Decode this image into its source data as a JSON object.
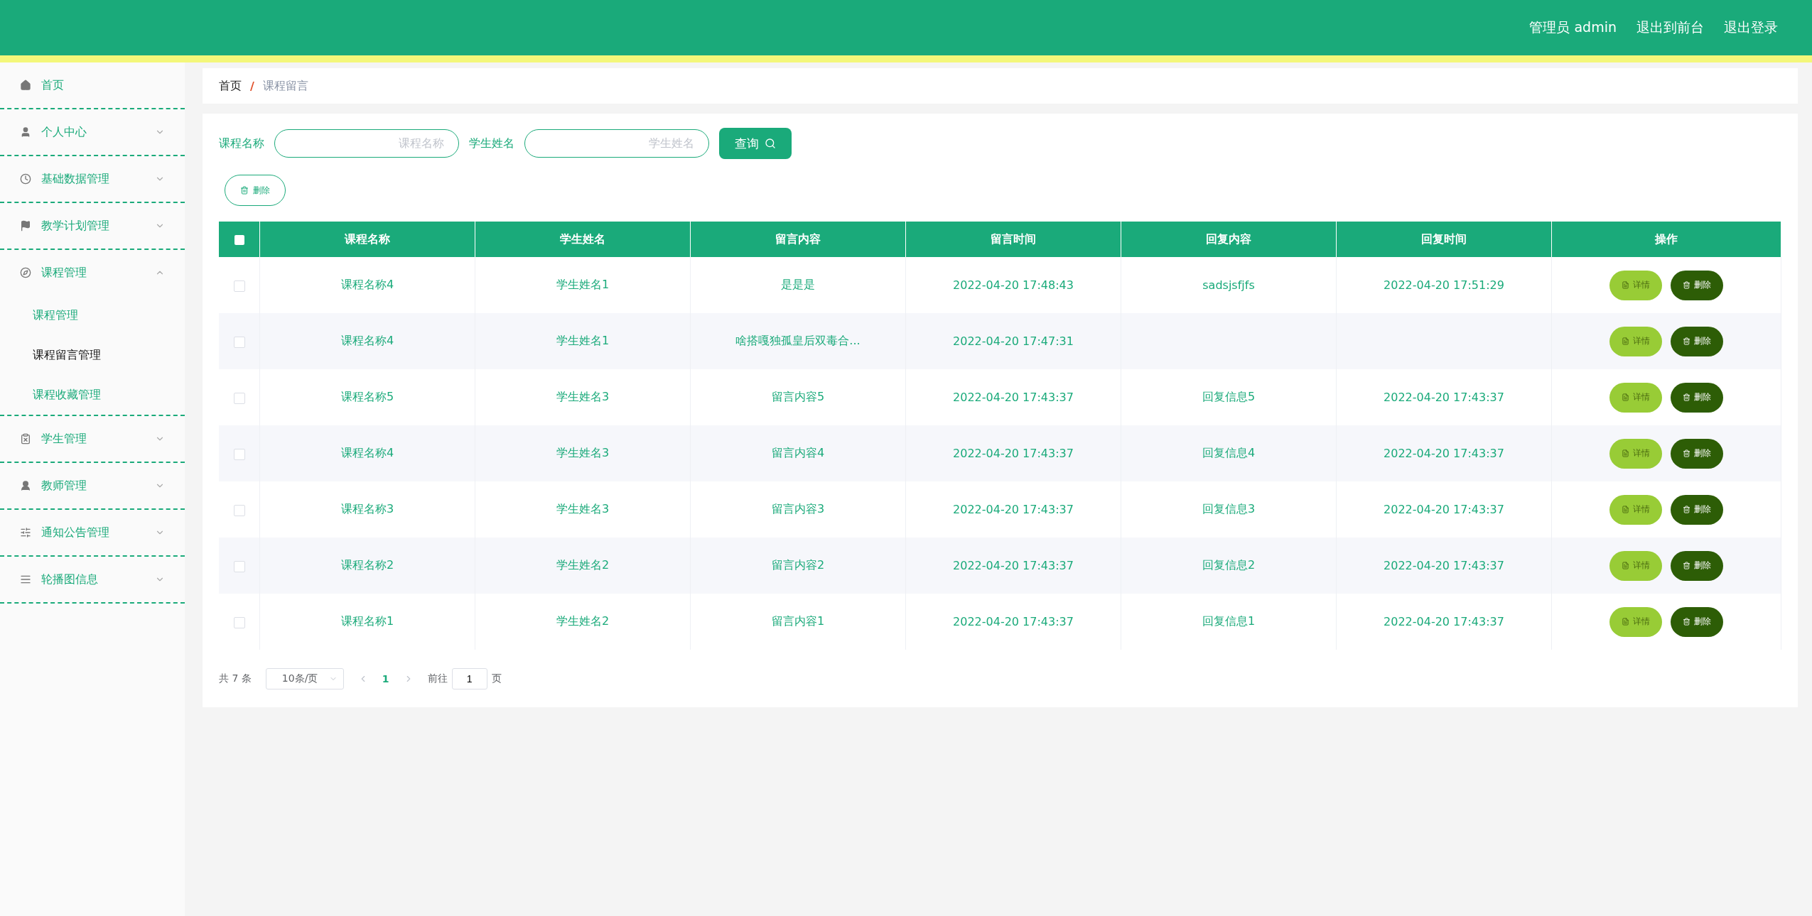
{
  "header": {
    "user": "管理员 admin",
    "links": [
      "退出到前台",
      "退出登录"
    ]
  },
  "sidebar": {
    "items": [
      {
        "label": "首页"
      },
      {
        "label": "个人中心",
        "expanded": false
      },
      {
        "label": "基础数据管理",
        "expanded": false
      },
      {
        "label": "教学计划管理",
        "expanded": false
      },
      {
        "label": "课程管理",
        "expanded": true,
        "children": [
          {
            "label": "课程管理",
            "selected": false
          },
          {
            "label": "课程留言管理",
            "selected": true
          },
          {
            "label": "课程收藏管理",
            "selected": false
          }
        ]
      },
      {
        "label": "学生管理",
        "expanded": false
      },
      {
        "label": "教师管理",
        "expanded": false
      },
      {
        "label": "通知公告管理",
        "expanded": false
      },
      {
        "label": "轮播图信息",
        "expanded": false
      }
    ]
  },
  "breadcrumb": {
    "home": "首页",
    "separator": "/",
    "current": "课程留言"
  },
  "filters": [
    {
      "label": "课程名称",
      "placeholder": "课程名称"
    },
    {
      "label": "学生姓名",
      "placeholder": "学生姓名"
    }
  ],
  "search_button": "查询",
  "delete_button": "删除",
  "table": {
    "select_all_checked": false,
    "columns": [
      "课程名称",
      "学生姓名",
      "留言内容",
      "留言时间",
      "回复内容",
      "回复时间",
      "操作"
    ],
    "rows": [
      {
        "checked": false,
        "cells": [
          "课程名称4",
          "学生姓名1",
          "是是是",
          "2022-04-20 17:48:43",
          "sadsjsfjfs",
          "2022-04-20 17:51:29"
        ],
        "actions": [
          "详情",
          "删除"
        ]
      },
      {
        "checked": false,
        "cells": [
          "课程名称4",
          "学生姓名1",
          "啥搭嘎独孤皇后双毒合...",
          "2022-04-20 17:47:31",
          "",
          ""
        ],
        "actions": [
          "详情",
          "删除"
        ]
      },
      {
        "checked": false,
        "cells": [
          "课程名称5",
          "学生姓名3",
          "留言内容5",
          "2022-04-20 17:43:37",
          "回复信息5",
          "2022-04-20 17:43:37"
        ],
        "actions": [
          "详情",
          "删除"
        ]
      },
      {
        "checked": false,
        "cells": [
          "课程名称4",
          "学生姓名3",
          "留言内容4",
          "2022-04-20 17:43:37",
          "回复信息4",
          "2022-04-20 17:43:37"
        ],
        "actions": [
          "详情",
          "删除"
        ]
      },
      {
        "checked": false,
        "cells": [
          "课程名称3",
          "学生姓名3",
          "留言内容3",
          "2022-04-20 17:43:37",
          "回复信息3",
          "2022-04-20 17:43:37"
        ],
        "actions": [
          "详情",
          "删除"
        ]
      },
      {
        "checked": false,
        "cells": [
          "课程名称2",
          "学生姓名2",
          "留言内容2",
          "2022-04-20 17:43:37",
          "回复信息2",
          "2022-04-20 17:43:37"
        ],
        "actions": [
          "详情",
          "删除"
        ]
      },
      {
        "checked": false,
        "cells": [
          "课程名称1",
          "学生姓名2",
          "留言内容1",
          "2022-04-20 17:43:37",
          "回复信息1",
          "2022-04-20 17:43:37"
        ],
        "actions": [
          "详情",
          "删除"
        ]
      }
    ]
  },
  "pagination": {
    "total": "共 7 条",
    "page_size": "10条/页",
    "pages": [
      {
        "label": "1",
        "selected": true
      }
    ],
    "goto_label": "前往",
    "goto_value": "1",
    "goto_suffix": "页"
  }
}
